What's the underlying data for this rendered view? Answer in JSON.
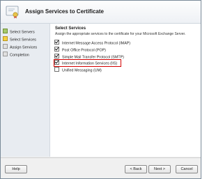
{
  "window": {
    "title": "Assign Services to Certificate"
  },
  "sidebar": {
    "steps": [
      {
        "label": "Select Servers",
        "state": "done"
      },
      {
        "label": "Select Services",
        "state": "current"
      },
      {
        "label": "Assign Services",
        "state": "pending"
      },
      {
        "label": "Completion",
        "state": "pending"
      }
    ]
  },
  "main": {
    "section_title": "Select Services",
    "description": "Assign the appropriate services to the certificate for your Microsoft Exchange Server.",
    "services": [
      {
        "label": "Internet Message Access Protocol (IMAP)",
        "checked": true
      },
      {
        "label": "Post Office Protocol (POP)",
        "checked": true
      },
      {
        "label": "Simple Mail Transfer Protocol (SMTP)",
        "checked": true
      },
      {
        "label": "Internet Information Services (IIS)",
        "checked": true,
        "highlighted": true
      },
      {
        "label": "Unified Messaging (UM)",
        "checked": false
      }
    ],
    "highlight_color": "#d40000"
  },
  "footer": {
    "help_label": "Help",
    "back_label": "< Back",
    "next_label": "Next >",
    "cancel_label": "Cancel"
  }
}
